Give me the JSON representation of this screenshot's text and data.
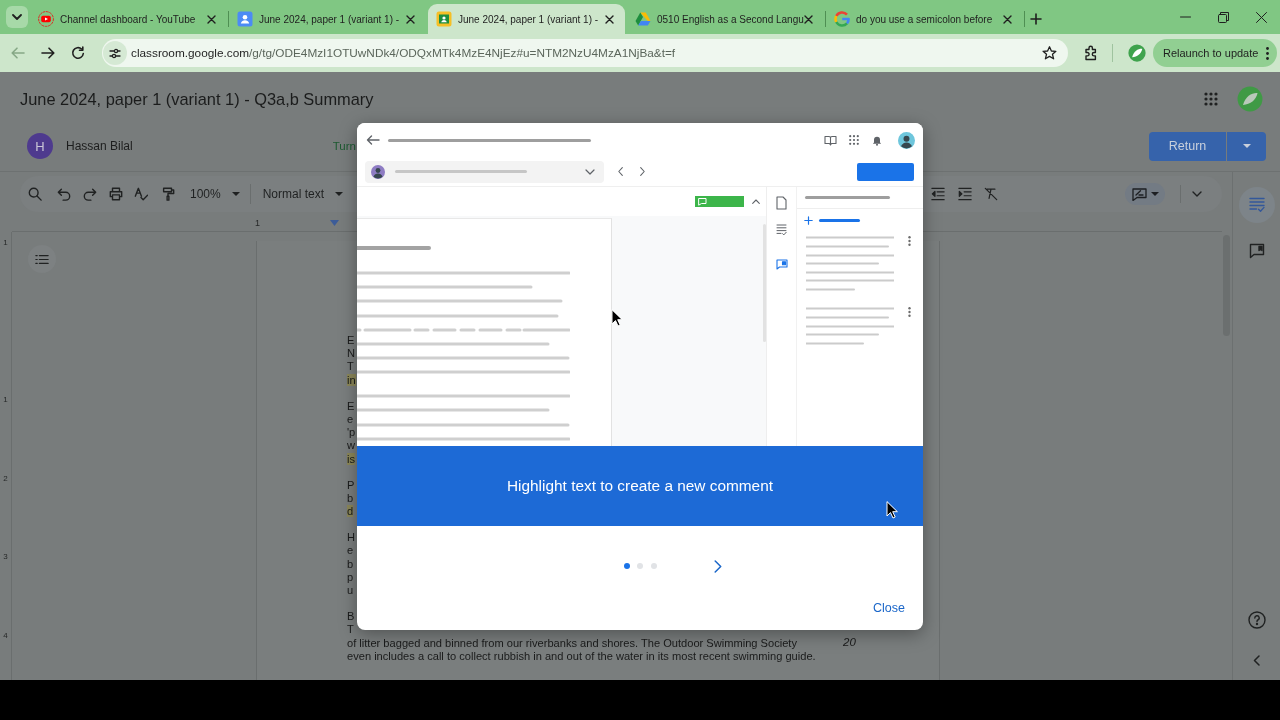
{
  "browser": {
    "tabs": [
      {
        "kind": "youtube",
        "title": "Channel dashboard - YouTube",
        "selected": false
      },
      {
        "kind": "contact",
        "title": "June 2024, paper 1 (variant 1) -",
        "selected": false
      },
      {
        "kind": "classroom",
        "title": "June 2024, paper 1 (variant 1) -",
        "selected": true
      },
      {
        "kind": "drive",
        "title": "0510 English as a Second Langu",
        "selected": false
      },
      {
        "kind": "google",
        "title": "do you use a semicolon before",
        "selected": false
      }
    ],
    "nav": [
      {
        "kind": "back",
        "disabled": true
      },
      {
        "kind": "forward",
        "disabled": false
      },
      {
        "kind": "reload",
        "disabled": false
      }
    ],
    "address": {
      "host": "classroom.google.com",
      "path": "/g/tg/ODE4MzI1OTUwNDk4/ODQxMTk4MzE4NjEz#u=NTM2NzU4MzA1NjBa&t=f"
    },
    "relaunch_button": "Relaunch to update"
  },
  "page": {
    "title": "June 2024, paper 1 (variant 1) - Q3a,b Summary",
    "student": {
      "initial": "H",
      "name": "Hassan Bilal",
      "status": "Turn"
    },
    "return_button": "Return",
    "toolbar": {
      "zoom": "100%",
      "paragraph_style": "Normal text"
    },
    "ruler_label": "1",
    "vertical_ruler_labels": [
      "1",
      "1",
      "2",
      "3",
      "4"
    ],
    "document": {
      "paragraphs": [
        {
          "lines": [
            {
              "text": "E",
              "highlighted": false
            },
            {
              "text": "N",
              "highlighted": false
            },
            {
              "text": "T",
              "highlighted": false
            },
            {
              "text": "in",
              "highlighted": true
            }
          ]
        },
        {
          "lines": [
            {
              "text": "E",
              "highlighted": false
            },
            {
              "text": "e",
              "highlighted": false
            },
            {
              "text": "'p",
              "highlighted": false
            },
            {
              "text": "w",
              "highlighted": false
            },
            {
              "text": "is",
              "highlighted": true
            }
          ]
        },
        {
          "lines": [
            {
              "text": "P",
              "highlighted": false
            },
            {
              "text": "b",
              "highlighted": false
            },
            {
              "text": "d",
              "highlighted": true
            }
          ]
        },
        {
          "lines": [
            {
              "text": "H",
              "highlighted": false
            },
            {
              "text": "e",
              "highlighted": false
            },
            {
              "text": "b",
              "highlighted": false
            },
            {
              "text": "p",
              "highlighted": false
            },
            {
              "text": "u",
              "highlighted": false
            }
          ]
        },
        {
          "lines": [
            {
              "text": "B",
              "highlighted": false
            },
            {
              "text": "T",
              "highlighted": false
            },
            {
              "text": "of litter bagged and binned from our riverbanks and shores. The Outdoor Swimming Society",
              "highlighted": false,
              "line_number": "20"
            },
            {
              "text": "even includes a call to collect rubbish in and out of the water in its most recent swimming guide.",
              "highlighted": false
            }
          ]
        }
      ]
    },
    "side_panel": [
      {
        "kind": "rubric",
        "selected": true
      },
      {
        "kind": "comments",
        "selected": false
      }
    ]
  },
  "dialog": {
    "message": "Highlight text to create a new comment",
    "pages": [
      {
        "selected": true
      },
      {
        "selected": false
      },
      {
        "selected": false
      }
    ],
    "close_button": "Close"
  }
}
